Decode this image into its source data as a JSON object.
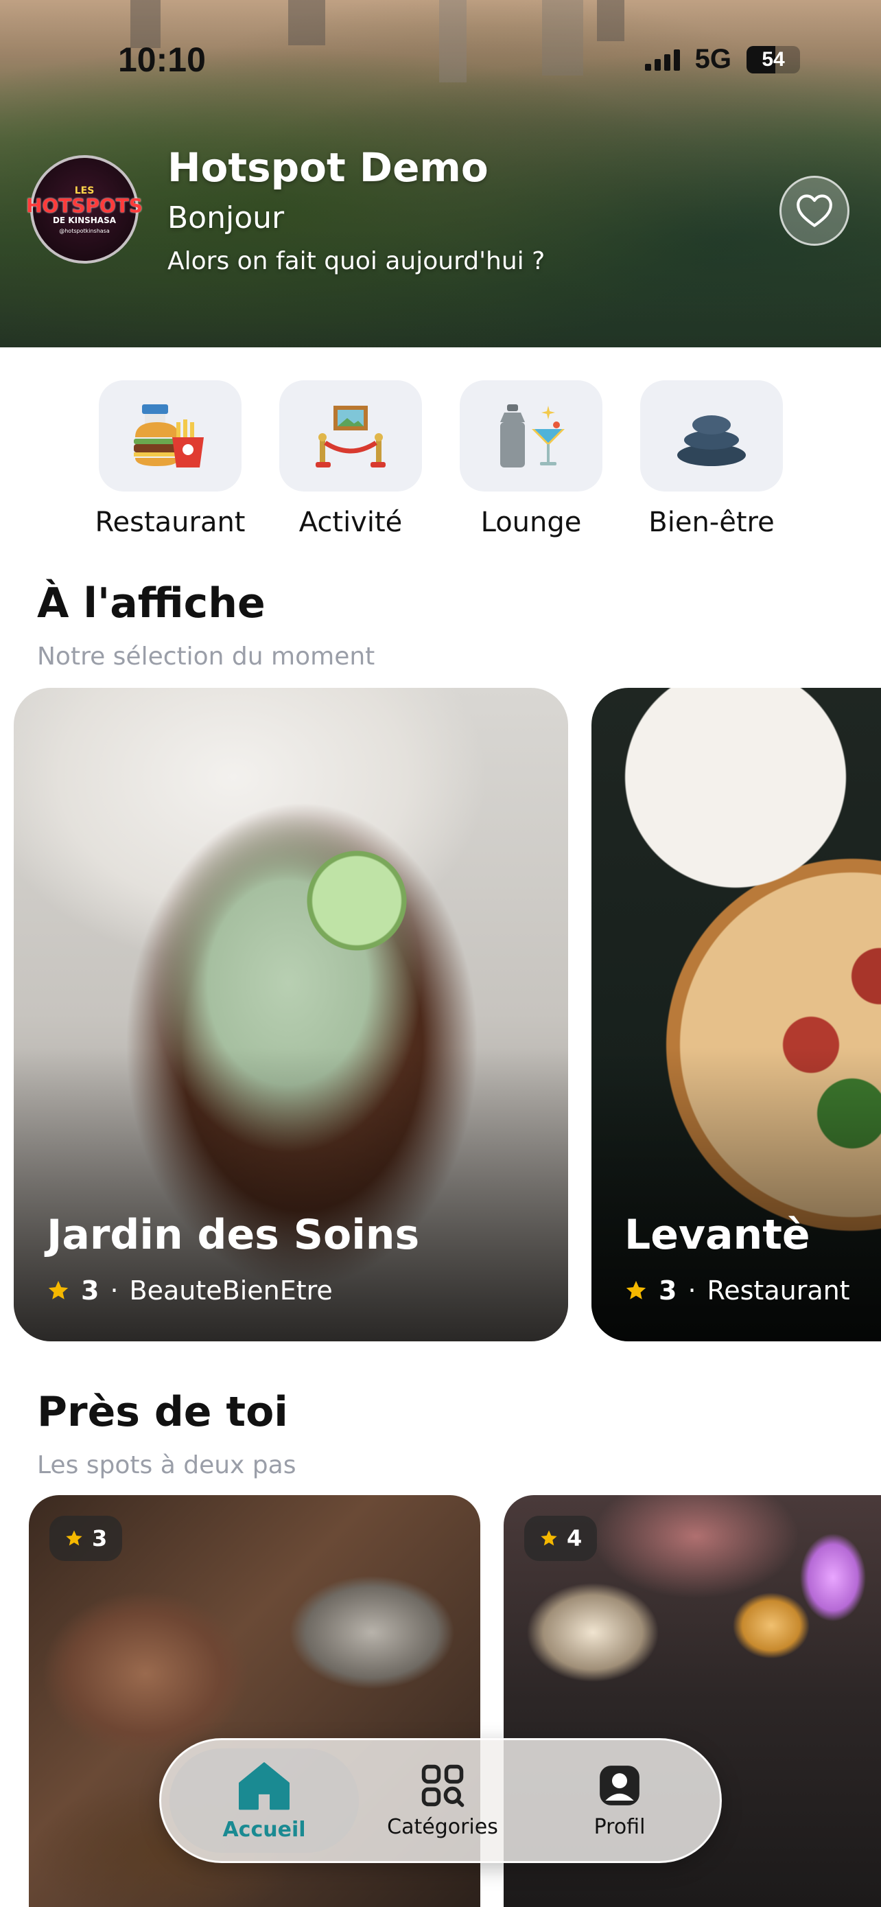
{
  "status_bar": {
    "time": "10:10",
    "network": "5G",
    "battery": "54",
    "battery_level": 0.54
  },
  "header": {
    "logo": {
      "line1": "LES",
      "line2": "HOTSPOTS",
      "line3": "DE KINSHASA",
      "line4": "@hotspotkinshasa"
    },
    "title": "Hotspot Demo",
    "greeting": "Bonjour",
    "subtitle": "Alors on fait quoi aujourd'hui ?",
    "favorite_icon": "heart-outline-icon"
  },
  "categories": [
    {
      "label": "Restaurant",
      "icon": "burger-fries-icon"
    },
    {
      "label": "Activité",
      "icon": "museum-exhibit-icon"
    },
    {
      "label": "Lounge",
      "icon": "cocktail-shaker-icon"
    },
    {
      "label": "Bien-être",
      "icon": "spa-stones-icon"
    }
  ],
  "featured": {
    "title": "À l'affiche",
    "subtitle": "Notre sélection du moment",
    "cards": [
      {
        "name": "Jardin des Soins",
        "rating": "3",
        "category": "BeauteBienEtre"
      },
      {
        "name": "Levantè",
        "rating": "3",
        "category": "Restaurant"
      }
    ]
  },
  "nearby": {
    "title": "Près de toi",
    "subtitle": "Les spots à deux pas",
    "cards": [
      {
        "rating": "3"
      },
      {
        "rating": "4"
      }
    ]
  },
  "tabbar": {
    "active_color": "#1a8a92",
    "items": [
      {
        "label": "Accueil",
        "icon": "home-icon"
      },
      {
        "label": "Catégories",
        "icon": "categories-grid-icon"
      },
      {
        "label": "Profil",
        "icon": "profile-icon"
      }
    ]
  }
}
